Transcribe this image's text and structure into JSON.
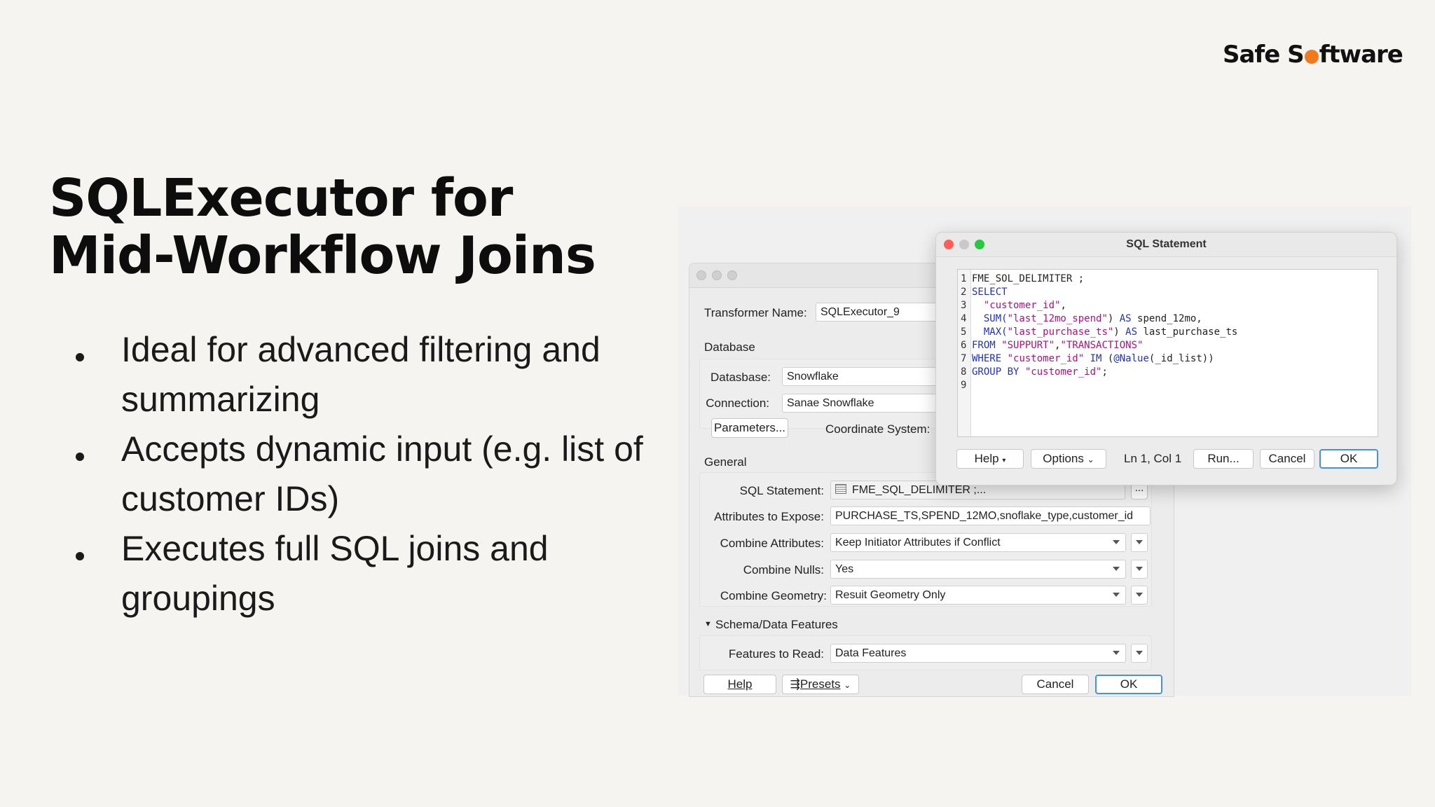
{
  "brand": {
    "logo_before": "Safe S",
    "logo_after": "ftware"
  },
  "slide": {
    "title_line1": "SQLExecutor for",
    "title_line2": "Mid-Workflow Joins",
    "bullets": [
      "Ideal for advanced filtering and summarizing",
      "Accepts dynamic input (e.g. list of customer IDs)",
      "Executes full SQL joins and groupings"
    ]
  },
  "main_dialog": {
    "transformer_name_label": "Transformer Name:",
    "transformer_name_value": "SQLExecutor_9",
    "database_section": "Database",
    "database_label": "Datasbase:",
    "database_value": "Snowflake",
    "connection_label": "Connection:",
    "connection_value": "Sanae Snowflake",
    "parameters_button": "Parameters...",
    "coordinate_system_label": "Coordinate System:",
    "general_section": "General",
    "sql_statement_label": "SQL Statement:",
    "sql_statement_value": "FME_SQL_DELIMITER  ;...",
    "sql_more_button": "...",
    "attributes_label": "Attributes to Expose:",
    "attributes_value": "PURCHASE_TS,SPEND_12MO,snoflake_type,customer_id",
    "combine_attributes_label": "Combine Attributes:",
    "combine_attributes_value": "Keep Initiator Attributes if Conflict",
    "combine_nulls_label": "Combine Nulls:",
    "combine_nulls_value": "Yes",
    "combine_geometry_label": "Combine Geometry:",
    "combine_geometry_value": "Resuit Geometry Only",
    "schema_section": "Schema/Data Features",
    "features_label": "Features to Read:",
    "features_value": "Data Features",
    "help_button": "Help",
    "presets_button": "Presets",
    "cancel_button": "Cancel",
    "ok_button": "OK"
  },
  "sql_dialog": {
    "title": "SQL Statement",
    "code": [
      {
        "n": "1",
        "parts": [
          {
            "t": "FME_SOL_DELIMITER ;",
            "c": ""
          }
        ]
      },
      {
        "n": "2",
        "parts": [
          {
            "t": "SELECT",
            "c": "kw"
          }
        ]
      },
      {
        "n": "3",
        "parts": [
          {
            "t": "  ",
            "c": ""
          },
          {
            "t": "\"customer_id\"",
            "c": "str"
          },
          {
            "t": ",",
            "c": ""
          }
        ]
      },
      {
        "n": "4",
        "parts": [
          {
            "t": "  ",
            "c": ""
          },
          {
            "t": "SUM(",
            "c": "fn"
          },
          {
            "t": "\"last_12mo_spend\"",
            "c": "str"
          },
          {
            "t": ") ",
            "c": ""
          },
          {
            "t": "AS",
            "c": "kw"
          },
          {
            "t": " spend_12mo,",
            "c": ""
          }
        ]
      },
      {
        "n": "5",
        "parts": [
          {
            "t": "  ",
            "c": ""
          },
          {
            "t": "MAX(",
            "c": "fn"
          },
          {
            "t": "\"last_purchase_ts\"",
            "c": "str"
          },
          {
            "t": ") ",
            "c": ""
          },
          {
            "t": "AS",
            "c": "kw"
          },
          {
            "t": " last_purchase_ts",
            "c": ""
          }
        ]
      },
      {
        "n": "6",
        "parts": [
          {
            "t": "FROM",
            "c": "kw"
          },
          {
            "t": " ",
            "c": ""
          },
          {
            "t": "\"SUPPURT\"",
            "c": "str"
          },
          {
            "t": ",",
            "c": ""
          },
          {
            "t": "\"TRANSACTIONS\"",
            "c": "str"
          }
        ]
      },
      {
        "n": "7",
        "parts": [
          {
            "t": "WHERE",
            "c": "kw"
          },
          {
            "t": " ",
            "c": ""
          },
          {
            "t": "\"customer_id\"",
            "c": "str"
          },
          {
            "t": " ",
            "c": ""
          },
          {
            "t": "IM",
            "c": "kw"
          },
          {
            "t": " (",
            "c": ""
          },
          {
            "t": "@Nalue",
            "c": "fn"
          },
          {
            "t": "(_id_list))",
            "c": ""
          }
        ]
      },
      {
        "n": "8",
        "parts": [
          {
            "t": "GROUP BY",
            "c": "kw"
          },
          {
            "t": " ",
            "c": ""
          },
          {
            "t": "\"customer_id\"",
            "c": "str"
          },
          {
            "t": ";",
            "c": ""
          }
        ]
      },
      {
        "n": "9",
        "parts": []
      }
    ],
    "help_button": "Help",
    "options_button": "Options",
    "cursor_position": "Ln 1, Col 1",
    "run_button": "Run...",
    "cancel_button": "Cancel",
    "ok_button": "OK"
  }
}
